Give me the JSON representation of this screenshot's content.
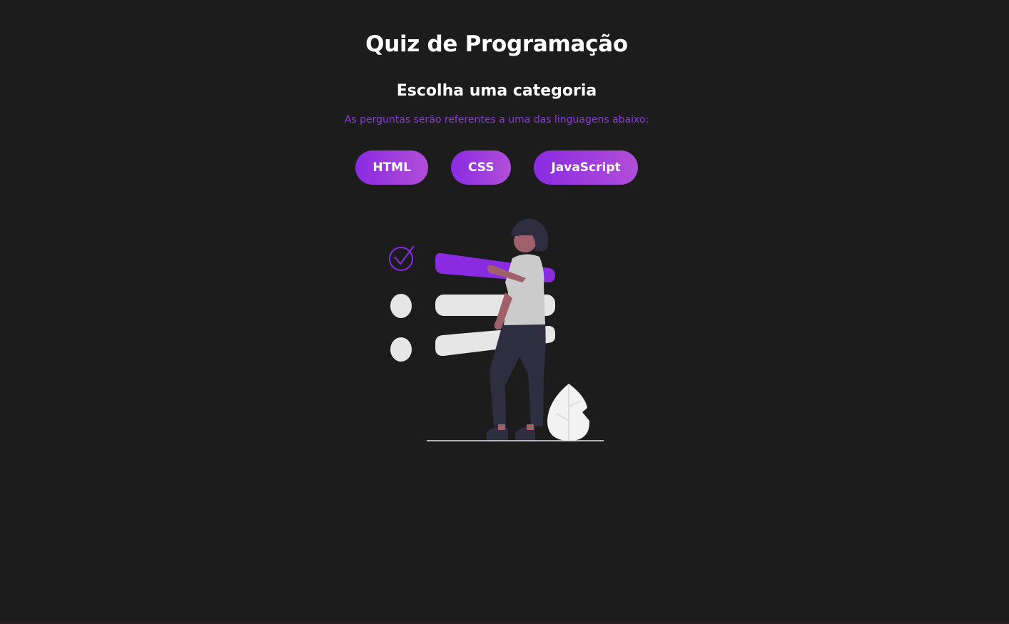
{
  "header": {
    "title": "Quiz de Programação",
    "subtitle": "Escolha uma categoria",
    "description": "As perguntas serão referentes a uma das linguagens abaixo:"
  },
  "categories": [
    {
      "label": "HTML"
    },
    {
      "label": "CSS"
    },
    {
      "label": "JavaScript"
    }
  ],
  "colors": {
    "background": "#1c1c1d",
    "accent": "#8a2be2",
    "accent_light": "#b14ed8",
    "text": "#ffffff"
  },
  "illustration": {
    "icon": "quiz-checklist-illustration"
  }
}
